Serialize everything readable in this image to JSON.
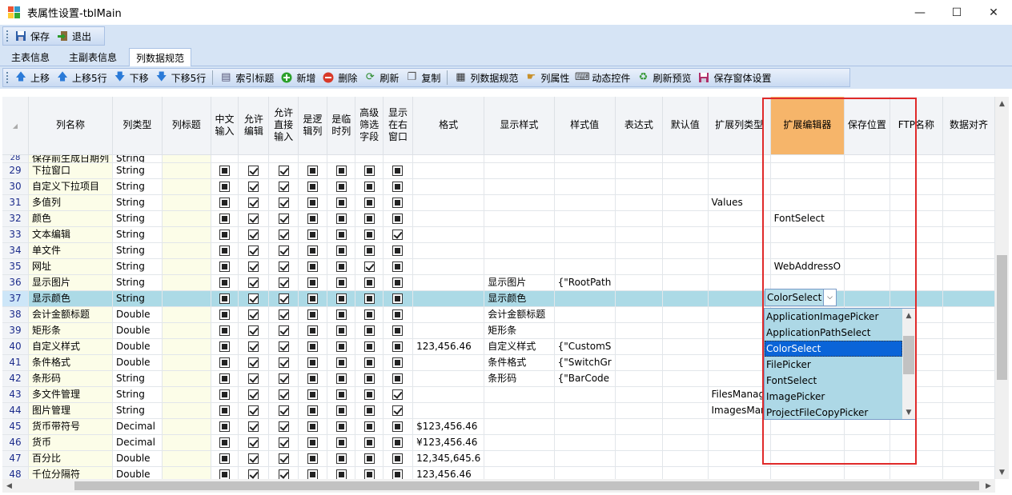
{
  "window": {
    "title": "表属性设置-tblMain",
    "minimize": "—",
    "maximize": "☐",
    "close": "✕"
  },
  "toolbar1": {
    "save": "保存",
    "exit": "退出"
  },
  "tabs": [
    "主表信息",
    "主副表信息",
    "列数据规范"
  ],
  "toolbar2": [
    "上移",
    "上移5行",
    "下移",
    "下移5行",
    "索引标题",
    "新增",
    "删除",
    "刷新",
    "复制",
    "列数据规范",
    "列属性",
    "动态控件",
    "刷新预览",
    "保存窗体设置"
  ],
  "grid": {
    "headers": [
      "列名称",
      "列类型",
      "列标题",
      "中文输入",
      "允许编辑",
      "允许直接输入",
      "是逻辑列",
      "是临时列",
      "高级筛选字段",
      "显示在右窗口",
      "格式",
      "显示样式",
      "样式值",
      "表达式",
      "默认值",
      "扩展列类型",
      "扩展编辑器",
      "保存位置",
      "FTP名称",
      "数据对齐"
    ],
    "partial_row": {
      "num": "28",
      "name": "保存前生成日期列",
      "type": "String"
    },
    "rows": [
      {
        "num": "29",
        "name": "下拉窗口",
        "type": "String",
        "flags": [
          "i",
          "c",
          "c",
          "i",
          "i",
          "i",
          "i"
        ],
        "format": "",
        "style": "",
        "style_value": "",
        "ext_type": "",
        "ext_editor": ""
      },
      {
        "num": "30",
        "name": "自定义下拉项目",
        "type": "String",
        "flags": [
          "i",
          "c",
          "c",
          "i",
          "i",
          "i",
          "i"
        ],
        "format": "",
        "style": "",
        "style_value": "",
        "ext_type": "",
        "ext_editor": ""
      },
      {
        "num": "31",
        "name": "多值列",
        "type": "String",
        "flags": [
          "i",
          "c",
          "c",
          "i",
          "i",
          "i",
          "i"
        ],
        "format": "",
        "style": "",
        "style_value": "",
        "ext_type": "Values",
        "ext_editor": ""
      },
      {
        "num": "32",
        "name": "颜色",
        "type": "String",
        "flags": [
          "i",
          "c",
          "c",
          "i",
          "i",
          "i",
          "i"
        ],
        "format": "",
        "style": "",
        "style_value": "",
        "ext_type": "",
        "ext_editor": "FontSelect"
      },
      {
        "num": "33",
        "name": "文本编辑",
        "type": "String",
        "flags": [
          "i",
          "c",
          "c",
          "i",
          "i",
          "i",
          "c"
        ],
        "format": "",
        "style": "",
        "style_value": "",
        "ext_type": "",
        "ext_editor": ""
      },
      {
        "num": "34",
        "name": "单文件",
        "type": "String",
        "flags": [
          "i",
          "c",
          "c",
          "i",
          "i",
          "i",
          "i"
        ],
        "format": "",
        "style": "",
        "style_value": "",
        "ext_type": "",
        "ext_editor": ""
      },
      {
        "num": "35",
        "name": "网址",
        "type": "String",
        "flags": [
          "i",
          "c",
          "c",
          "i",
          "i",
          "c",
          "i"
        ],
        "format": "",
        "style": "",
        "style_value": "",
        "ext_type": "",
        "ext_editor": "WebAddressO"
      },
      {
        "num": "36",
        "name": "显示图片",
        "type": "String",
        "flags": [
          "i",
          "c",
          "c",
          "i",
          "i",
          "i",
          "i"
        ],
        "format": "",
        "style": "显示图片",
        "style_value": "{\"RootPath",
        "ext_type": "",
        "ext_editor": ""
      },
      {
        "num": "37",
        "name": "显示颜色",
        "type": "String",
        "flags": [
          "i",
          "c",
          "c",
          "i",
          "i",
          "i",
          "i"
        ],
        "format": "",
        "style": "显示颜色",
        "style_value": "",
        "ext_type": "",
        "ext_editor": ""
      },
      {
        "num": "38",
        "name": "会计金额标题",
        "type": "Double",
        "flags": [
          "i",
          "c",
          "c",
          "i",
          "i",
          "i",
          "i"
        ],
        "format": "",
        "style": "会计金额标题",
        "style_value": "",
        "ext_type": "",
        "ext_editor": ""
      },
      {
        "num": "39",
        "name": "矩形条",
        "type": "Double",
        "flags": [
          "i",
          "c",
          "c",
          "i",
          "i",
          "i",
          "i"
        ],
        "format": "",
        "style": "矩形条",
        "style_value": "",
        "ext_type": "",
        "ext_editor": ""
      },
      {
        "num": "40",
        "name": "自定义样式",
        "type": "Double",
        "flags": [
          "i",
          "c",
          "c",
          "i",
          "i",
          "i",
          "i"
        ],
        "format": "123,456.46",
        "style": "自定义样式",
        "style_value": "{\"CustomS",
        "ext_type": "",
        "ext_editor": ""
      },
      {
        "num": "41",
        "name": "条件格式",
        "type": "Double",
        "flags": [
          "i",
          "c",
          "c",
          "i",
          "i",
          "i",
          "i"
        ],
        "format": "",
        "style": "条件格式",
        "style_value": "{\"SwitchGr",
        "ext_type": "",
        "ext_editor": ""
      },
      {
        "num": "42",
        "name": "条形码",
        "type": "String",
        "flags": [
          "i",
          "c",
          "c",
          "i",
          "i",
          "i",
          "i"
        ],
        "format": "",
        "style": "条形码",
        "style_value": "{\"BarCode",
        "ext_type": "",
        "ext_editor": ""
      },
      {
        "num": "43",
        "name": "多文件管理",
        "type": "String",
        "flags": [
          "i",
          "c",
          "c",
          "i",
          "i",
          "i",
          "c"
        ],
        "format": "",
        "style": "",
        "style_value": "",
        "ext_type": "FilesManag",
        "ext_editor": ""
      },
      {
        "num": "44",
        "name": "图片管理",
        "type": "String",
        "flags": [
          "i",
          "c",
          "c",
          "i",
          "i",
          "i",
          "c"
        ],
        "format": "",
        "style": "",
        "style_value": "",
        "ext_type": "ImagesMan",
        "ext_editor": ""
      },
      {
        "num": "45",
        "name": "货币带符号",
        "type": "Decimal",
        "flags": [
          "i",
          "c",
          "c",
          "i",
          "i",
          "i",
          "i"
        ],
        "format": "$123,456.46",
        "style": "",
        "style_value": "",
        "ext_type": "",
        "ext_editor": ""
      },
      {
        "num": "46",
        "name": "货币",
        "type": "Decimal",
        "flags": [
          "i",
          "c",
          "c",
          "i",
          "i",
          "i",
          "i"
        ],
        "format": "¥123,456.46",
        "style": "",
        "style_value": "",
        "ext_type": "",
        "ext_editor": ""
      },
      {
        "num": "47",
        "name": "百分比",
        "type": "Double",
        "flags": [
          "i",
          "c",
          "c",
          "i",
          "i",
          "i",
          "i"
        ],
        "format": "12,345,645.6",
        "style": "",
        "style_value": "",
        "ext_type": "",
        "ext_editor": ""
      },
      {
        "num": "48",
        "name": "千位分隔符",
        "type": "Double",
        "flags": [
          "i",
          "c",
          "c",
          "i",
          "i",
          "i",
          "i"
        ],
        "format": "123,456.46",
        "style": "",
        "style_value": "",
        "ext_type": "",
        "ext_editor": ""
      }
    ],
    "selected_row": "37"
  },
  "editor": {
    "value": "ColorSelect",
    "options": [
      "ApplicationImagePicker",
      "ApplicationPathSelect",
      "ColorSelect",
      "FilePicker",
      "FontSelect",
      "ImagePicker",
      "ProjectFileCopyPicker"
    ]
  },
  "colors": {
    "selection": "#acdae6",
    "header_highlight": "#f6b56a",
    "red_box": "#e02a2a",
    "toolbar": "#d6e4f5"
  }
}
